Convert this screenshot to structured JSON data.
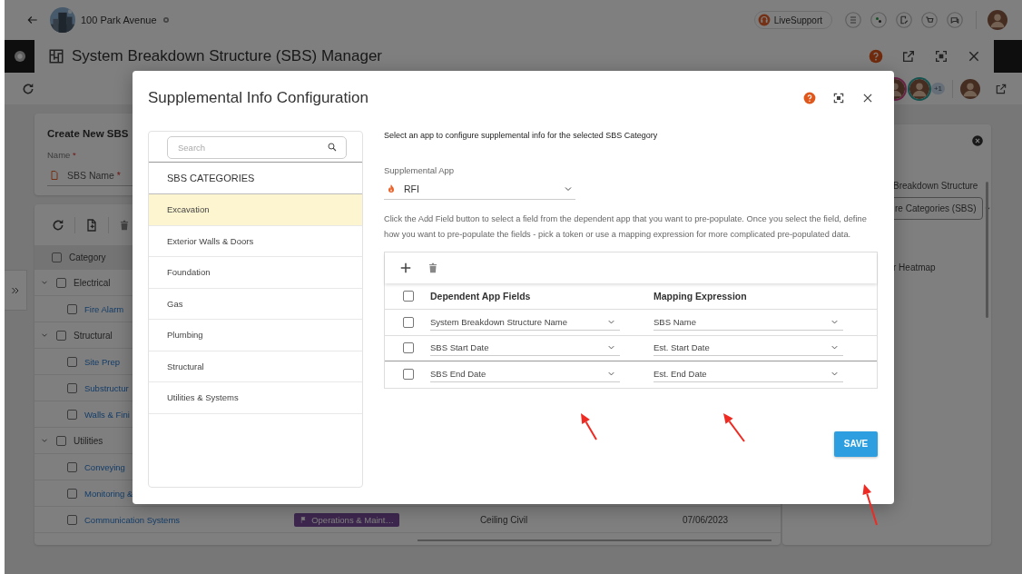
{
  "top_bar": {
    "project": "100 Park Avenue",
    "support_button": "LiveSupport"
  },
  "manager": {
    "title": "System Breakdown Structure (SBS) Manager",
    "collaborators_more": "+1",
    "create_form": {
      "title": "Create New SBS",
      "name_label": "Name",
      "name_required": "*",
      "field_label": "SBS Name",
      "field_required": "*"
    },
    "tree": {
      "column": "Category",
      "header_checked": false,
      "rows": [
        {
          "label": "Electrical",
          "checked": false,
          "expanded": true,
          "children": [
            {
              "label": "Fire Alarm",
              "checked": false
            }
          ]
        },
        {
          "label": "Structural",
          "checked": false,
          "expanded": true,
          "children": [
            {
              "label": "Site Prep",
              "checked": false
            },
            {
              "label": "Substructur",
              "checked": false
            },
            {
              "label": "Walls & Fini",
              "checked": false
            }
          ]
        },
        {
          "label": "Utilities",
          "checked": false,
          "expanded": true,
          "children": [
            {
              "label": "Conveying",
              "checked": false
            },
            {
              "label": "Monitoring &",
              "checked": false
            },
            {
              "label": "Communication Systems",
              "checked": false,
              "tag": "Operations & Maint…",
              "cells": [
                "Ceiling Civil",
                "07/06/2023"
              ]
            }
          ]
        }
      ]
    },
    "side_panel": {
      "label": "Breakdown Structure",
      "dropdown": "re Categories (SBS)",
      "option": "r Heatmap"
    }
  },
  "dialog": {
    "title": "Supplemental Info Configuration",
    "search_placeholder": "Search",
    "categories_heading": "SBS CATEGORIES",
    "categories": [
      {
        "label": "Excavation",
        "selected": true
      },
      {
        "label": "Exterior Walls & Doors",
        "selected": false
      },
      {
        "label": "Foundation",
        "selected": false
      },
      {
        "label": "Gas",
        "selected": false
      },
      {
        "label": "Plumbing",
        "selected": false
      },
      {
        "label": "Structural",
        "selected": false
      },
      {
        "label": "Utilities & Systems",
        "selected": false
      }
    ],
    "intro": "Select an app to configure supplemental info for the selected SBS Category",
    "app_label": "Supplemental App",
    "app_value": "RFI",
    "help_text": "Click the Add Field button to select a field from the dependent app that you want to pre-populate. Once you select the field, define how you want to pre-populate the fields - pick a token or use a mapping expression for more complicated pre-populated data.",
    "mapping_table": {
      "columns": [
        "Dependent App Fields",
        "Mapping Expression"
      ],
      "header_checked": false,
      "rows": [
        {
          "checked": false,
          "field": "System Breakdown Structure Name",
          "expression": "SBS Name"
        },
        {
          "checked": false,
          "field": "SBS Start Date",
          "expression": "Est. Start Date"
        },
        {
          "checked": false,
          "field": "SBS End Date",
          "expression": "Est. End Date"
        }
      ]
    },
    "save_button": "SAVE"
  }
}
